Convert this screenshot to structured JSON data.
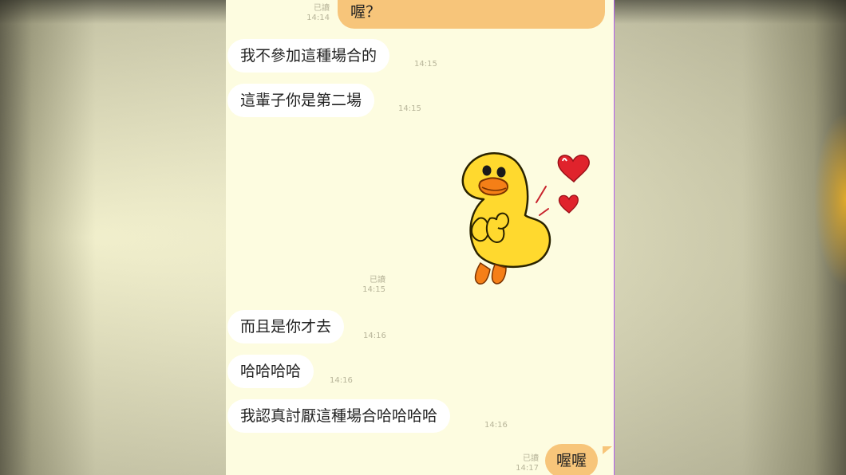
{
  "chat": {
    "messages": [
      {
        "dir": "out",
        "text": "喔？",
        "read": "已讀",
        "time": "14:14"
      },
      {
        "dir": "in",
        "text": "我不參加這種場合的",
        "time": "14:15"
      },
      {
        "dir": "in",
        "text": "這輩子你是第二場",
        "time": "14:15"
      },
      {
        "dir": "out",
        "type": "sticker",
        "sticker": "yellow-chick-with-hearts",
        "read": "已讀",
        "time": "14:15"
      },
      {
        "dir": "in",
        "text": "而且是你才去",
        "time": "14:16"
      },
      {
        "dir": "in",
        "text": "哈哈哈哈",
        "time": "14:16"
      },
      {
        "dir": "in",
        "text": "我認真討厭這種場合哈哈哈哈",
        "time": "14:16"
      },
      {
        "dir": "out",
        "text": "喔喔",
        "read": "已讀",
        "time": "14:17"
      }
    ]
  },
  "colors": {
    "chat_background": "#fdfce0",
    "incoming_bubble": "#ffffff",
    "outgoing_bubble": "#f7c57a",
    "meta_text": "#b8b59a"
  }
}
